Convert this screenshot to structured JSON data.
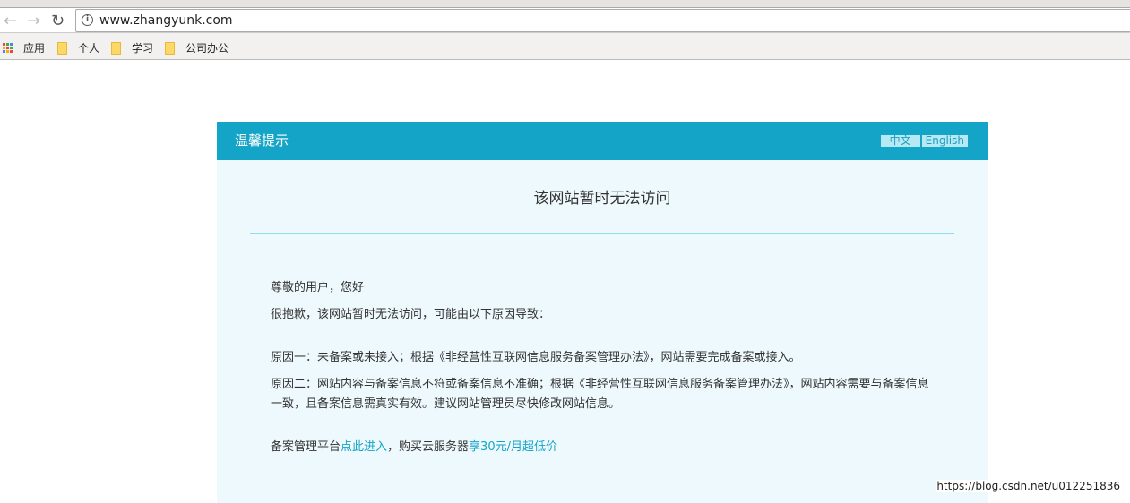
{
  "browser": {
    "url": "www.zhangyunk.com",
    "bookmarks": [
      "应用",
      "个人",
      "学习",
      "公司办公"
    ]
  },
  "header": {
    "title": "温馨提示",
    "lang_zh": "中文",
    "lang_en": "English"
  },
  "main": {
    "title": "该网站暂时无法访问",
    "greeting": "尊敬的用户，您好",
    "intro": "很抱歉，该网站暂时无法访问，可能由以下原因导致：",
    "reason1": "原因一：未备案或未接入；根据《非经营性互联网信息服务备案管理办法》，网站需要完成备案或接入。",
    "reason2": "原因二：网站内容与备案信息不符或备案信息不准确；根据《非经营性互联网信息服务备案管理办法》，网站内容需要与备案信息一致，且备案信息需真实有效。建议网站管理员尽快修改网站信息。",
    "platform_prefix": "备案管理平台",
    "platform_link": "点此进入",
    "buy_prefix": "，购买云服务器",
    "buy_link": "享30元/月超低价"
  },
  "watermark": "https://blog.csdn.net/u012251836"
}
